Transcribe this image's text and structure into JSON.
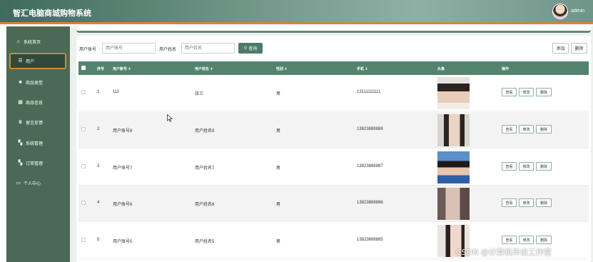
{
  "header": {
    "title": "智汇电脑商城购物系统",
    "admin": "admin"
  },
  "sidebar": {
    "items": [
      {
        "label": "系统首页",
        "icon": "home-icon"
      },
      {
        "label": "用户",
        "icon": "user-list-icon",
        "active": true
      },
      {
        "label": "商品类型",
        "icon": "box-icon"
      },
      {
        "label": "商品信息",
        "icon": "grid-icon"
      },
      {
        "label": "留言反馈",
        "icon": "trophy-icon"
      },
      {
        "label": "系统管理",
        "icon": "apps-icon"
      },
      {
        "label": "订单管理",
        "icon": "apps-icon"
      },
      {
        "label": "个人中心",
        "icon": "id-card-icon"
      }
    ]
  },
  "search": {
    "account_label": "用户账号",
    "account_placeholder": "用户账号",
    "name_label": "用户姓名",
    "name_placeholder": "用户姓名",
    "search_button": "查询"
  },
  "toolbar": {
    "add": "添加",
    "delete": "删除"
  },
  "table": {
    "headers": [
      "序号",
      "用户账号 ⇕",
      "用户姓名 ⇕",
      "性别 ⇕",
      "手机 ⇕",
      "头像",
      "操作"
    ],
    "rows": [
      {
        "index": "1",
        "account": "111",
        "name": "张三",
        "gender": "男",
        "phone": "13111111111"
      },
      {
        "index": "2",
        "account": "用户账号8",
        "name": "用户姓名8",
        "gender": "男",
        "phone": "13823888888"
      },
      {
        "index": "3",
        "account": "用户账号7",
        "name": "用户姓名7",
        "gender": "男",
        "phone": "13823888887"
      },
      {
        "index": "4",
        "account": "用户账号6",
        "name": "用户姓名6",
        "gender": "男",
        "phone": "13823888886"
      },
      {
        "index": "5",
        "account": "用户账号5",
        "name": "用户姓名5",
        "gender": "男",
        "phone": "13823888885"
      }
    ],
    "actions": {
      "view": "查看",
      "edit": "修改",
      "delete": "删除"
    }
  },
  "watermark": "CSDN @计算机毕设工作室",
  "colors": {
    "primary": "#54836d",
    "sidebar": "#4b6a55",
    "accent": "#d0873a"
  }
}
